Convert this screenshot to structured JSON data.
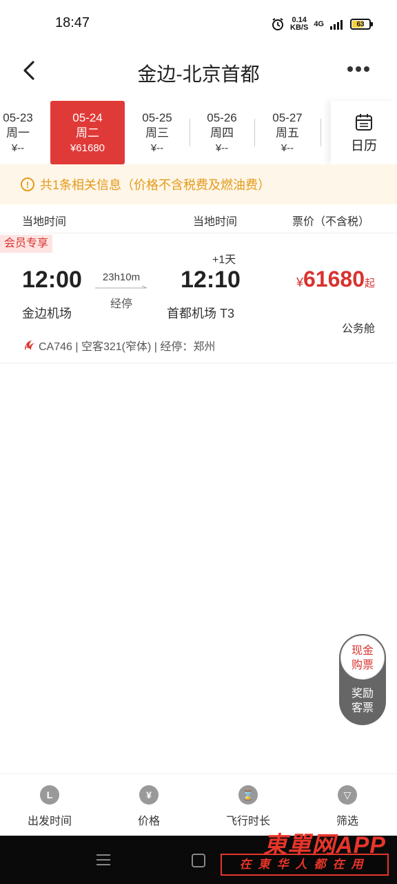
{
  "status_bar": {
    "time": "18:47",
    "net_speed_value": "0.14",
    "net_speed_unit": "KB/S",
    "signal_label": "4G",
    "battery": "63"
  },
  "header": {
    "title": "金边-北京首都"
  },
  "date_bar": {
    "items": [
      {
        "date": "05-23",
        "weekday": "周一",
        "price": "¥--"
      },
      {
        "date": "05-24",
        "weekday": "周二",
        "price": "¥61680"
      },
      {
        "date": "05-25",
        "weekday": "周三",
        "price": "¥--"
      },
      {
        "date": "05-26",
        "weekday": "周四",
        "price": "¥--"
      },
      {
        "date": "05-27",
        "weekday": "周五",
        "price": "¥--"
      }
    ],
    "selected_index": 1,
    "calendar_label": "日历"
  },
  "notice": {
    "icon": "!",
    "text": "共1条相关信息（价格不含税费及燃油费）"
  },
  "columns": {
    "departure": "当地时间",
    "arrival": "当地时间",
    "price": "票价（不含税）"
  },
  "flight": {
    "badge": "会员专享",
    "dep_time": "12:00",
    "arr_time": "12:10",
    "next_day": "+1天",
    "duration": "23h10m",
    "stop_label": "经停",
    "dep_airport": "金边机场",
    "arr_airport": "首都机场 T3",
    "price_symbol": "¥",
    "price": "61680",
    "price_suffix": "起",
    "cabin": "公务舱",
    "info": "CA746 | 空客321(窄体) | 经停：郑州"
  },
  "float_pill": {
    "cash_line1": "现金",
    "cash_line2": "购票",
    "award_line1": "奖励",
    "award_line2": "客票"
  },
  "tab_bar": {
    "items": [
      {
        "label": "出发时间",
        "icon": "L"
      },
      {
        "label": "价格",
        "icon": "¥"
      },
      {
        "label": "飞行时长",
        "icon": "⌛"
      },
      {
        "label": "筛选",
        "icon": "▽"
      }
    ]
  },
  "watermark": {
    "title": "東單网APP",
    "slogan": "在東华人都在用"
  },
  "colors": {
    "accent": "#e03a38",
    "notice_text": "#e49a1a",
    "notice_bg": "#fef6e8"
  }
}
